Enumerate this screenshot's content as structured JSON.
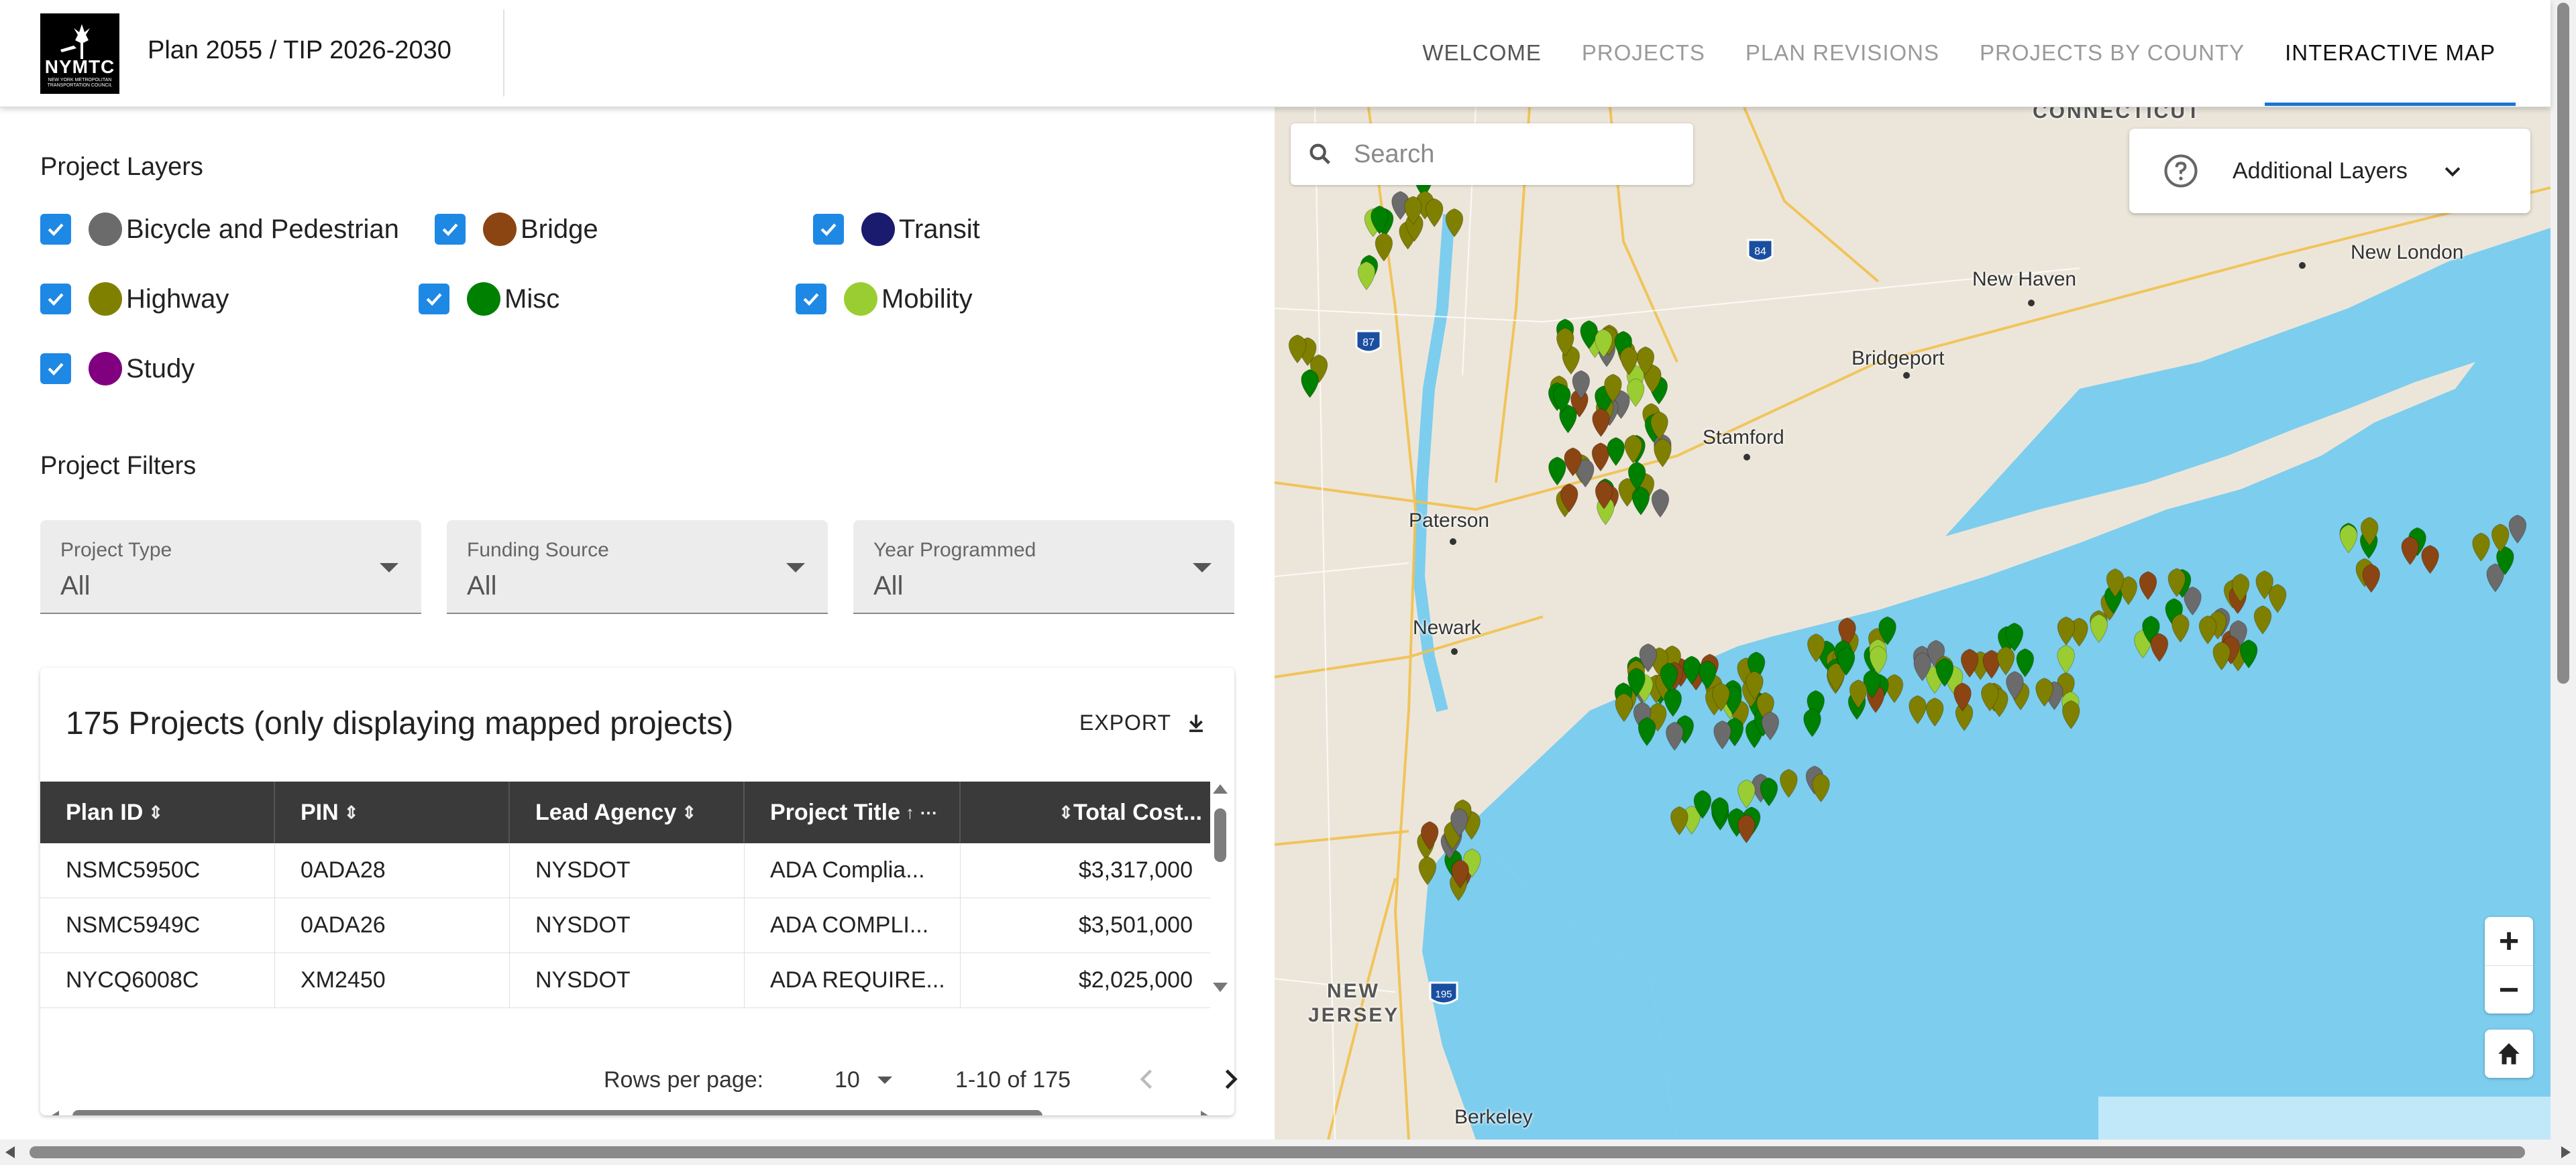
{
  "header": {
    "logo_text": "NYMTC",
    "logo_subtext": "NEW YORK METROPOLITAN TRANSPORTATION COUNCIL",
    "app_title": "Plan 2055 / TIP 2026-2030",
    "nav": [
      {
        "label": "WELCOME",
        "state": "dark"
      },
      {
        "label": "PROJECTS",
        "state": "muted"
      },
      {
        "label": "PLAN REVISIONS",
        "state": "muted"
      },
      {
        "label": "PROJECTS BY COUNTY",
        "state": "muted"
      },
      {
        "label": "INTERACTIVE MAP",
        "state": "active"
      }
    ]
  },
  "layers": {
    "title": "Project Layers",
    "items": [
      {
        "label": "Bicycle and Pedestrian",
        "color": "#6b6b6b",
        "checked": true
      },
      {
        "label": "Bridge",
        "color": "#8b4513",
        "checked": true
      },
      {
        "label": "Transit",
        "color": "#1a1a6e",
        "checked": true
      },
      {
        "label": "Highway",
        "color": "#808000",
        "checked": true
      },
      {
        "label": "Misc",
        "color": "#008000",
        "checked": true
      },
      {
        "label": "Mobility",
        "color": "#9acd32",
        "checked": true
      },
      {
        "label": "Study",
        "color": "#800080",
        "checked": true
      }
    ]
  },
  "filters": {
    "title": "Project Filters",
    "items": [
      {
        "label": "Project Type",
        "value": "All"
      },
      {
        "label": "Funding Source",
        "value": "All"
      },
      {
        "label": "Year Programmed",
        "value": "All"
      }
    ]
  },
  "projects": {
    "title": "175 Projects (only displaying mapped projects)",
    "export_label": "EXPORT",
    "columns": [
      "Plan ID",
      "PIN",
      "Lead Agency",
      "Project Title",
      "Total Cost..."
    ],
    "rows": [
      [
        "NSMC5950C",
        "0ADA28",
        "NYSDOT",
        "ADA Complia...",
        "$3,317,000"
      ],
      [
        "NSMC5949C",
        "0ADA26",
        "NYSDOT",
        "ADA COMPLI...",
        "$3,501,000"
      ],
      [
        "NYCQ6008C",
        "XM2450",
        "NYSDOT",
        "ADA REQUIRE...",
        "$2,025,000"
      ]
    ],
    "pagination": {
      "rows_per_page_label": "Rows per page:",
      "rows_per_page_value": "10",
      "range": "1-10 of 175"
    }
  },
  "map": {
    "search_placeholder": "Search",
    "additional_layers_label": "Additional Layers",
    "labels": [
      {
        "text": "CONNECTICUT",
        "kind": "region"
      },
      {
        "text": "New Haven",
        "kind": "city"
      },
      {
        "text": "New London",
        "kind": "city"
      },
      {
        "text": "Bridgeport",
        "kind": "city"
      },
      {
        "text": "Stamford",
        "kind": "city"
      },
      {
        "text": "Paterson",
        "kind": "city"
      },
      {
        "text": "Newark",
        "kind": "city"
      },
      {
        "text": "NEW",
        "kind": "region"
      },
      {
        "text": "JERSEY",
        "kind": "region"
      },
      {
        "text": "Berkeley",
        "kind": "city"
      }
    ],
    "highway_shields": [
      "87",
      "84",
      "195"
    ],
    "zoom_in": "+",
    "zoom_out": "−",
    "water_color": "#7dcdee",
    "land_color": "#ece6da"
  }
}
